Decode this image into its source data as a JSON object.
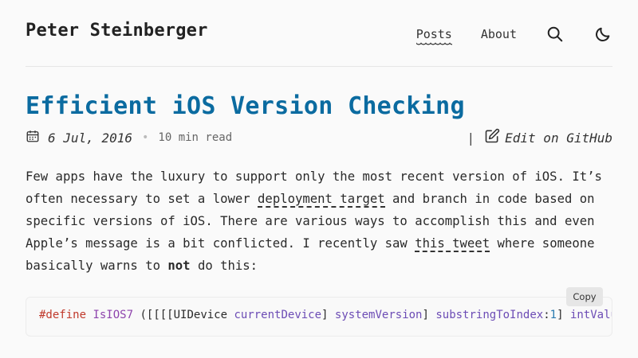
{
  "header": {
    "site_title": "Peter Steinberger",
    "nav": [
      {
        "label": "Posts",
        "active": true
      },
      {
        "label": "About",
        "active": false
      }
    ],
    "search_icon": "search-icon",
    "theme_icon": "moon-icon"
  },
  "post": {
    "title": "Efficient iOS Version Checking",
    "date": "6 Jul, 2016",
    "separator": "•",
    "read_time": "10 min read",
    "pipe": "|",
    "edit_label": "Edit on GitHub",
    "paragraph": {
      "t1": "Few apps have the luxury to support only the most recent version of iOS. It’s often necessary to set a lower ",
      "link1": "deployment target",
      "t2": " and branch in code based on specific versions of iOS. There are various ways to accomplish this and even Apple’s message is a bit conflicted. I recently saw ",
      "link2": "this tweet",
      "t3": " where someone basically warns to ",
      "bold": "not",
      "t4": " do this:"
    }
  },
  "code": {
    "copy_label": "Copy",
    "tokens": {
      "define": "#define",
      "macro": " IsIOS7",
      "open": " ([[[[UIDevice ",
      "currentDevice": "currentDevice",
      "close1": "] ",
      "systemVersion": "systemVersion",
      "close2": "] ",
      "substringToIndex": "substringToIndex",
      "colon": ":",
      "one": "1",
      "close3": "] ",
      "intValue": "intValue"
    }
  },
  "colors": {
    "title": "#0b6ba0",
    "background": "#fafafa",
    "code_keyword": "#c0392b",
    "code_method": "#6c4cb5",
    "code_number": "#2a7ab0"
  }
}
